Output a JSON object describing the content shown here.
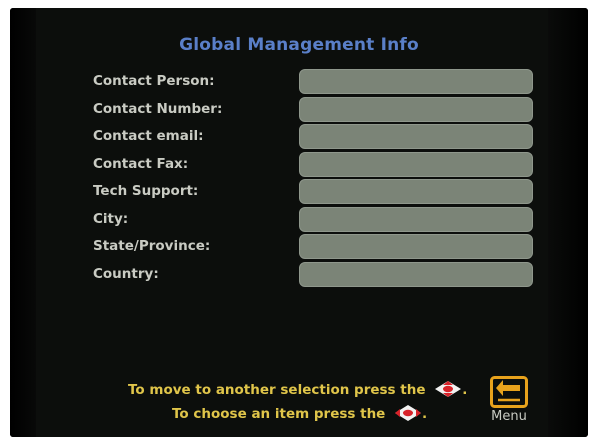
{
  "title": "Global Management Info",
  "fields": [
    {
      "label": "Contact Person:",
      "value": ""
    },
    {
      "label": "Contact Number:",
      "value": ""
    },
    {
      "label": "Contact email:",
      "value": ""
    },
    {
      "label": "Contact Fax:",
      "value": ""
    },
    {
      "label": "Tech Support:",
      "value": ""
    },
    {
      "label": "City:",
      "value": ""
    },
    {
      "label": "State/Province:",
      "value": ""
    },
    {
      "label": "Country:",
      "value": ""
    }
  ],
  "hints": {
    "move_text": "To move to another selection press the",
    "move_suffix": ".",
    "choose_text": "To choose an item press the",
    "choose_suffix": "."
  },
  "menu": {
    "label": "Menu",
    "icon": "back-arrow-icon"
  },
  "colors": {
    "title": "#5a7fc8",
    "hint": "#e0c54a",
    "field_bg": "#7b8477",
    "menu_accent": "#e8a21c",
    "direction_icon_red": "#d8232a"
  }
}
